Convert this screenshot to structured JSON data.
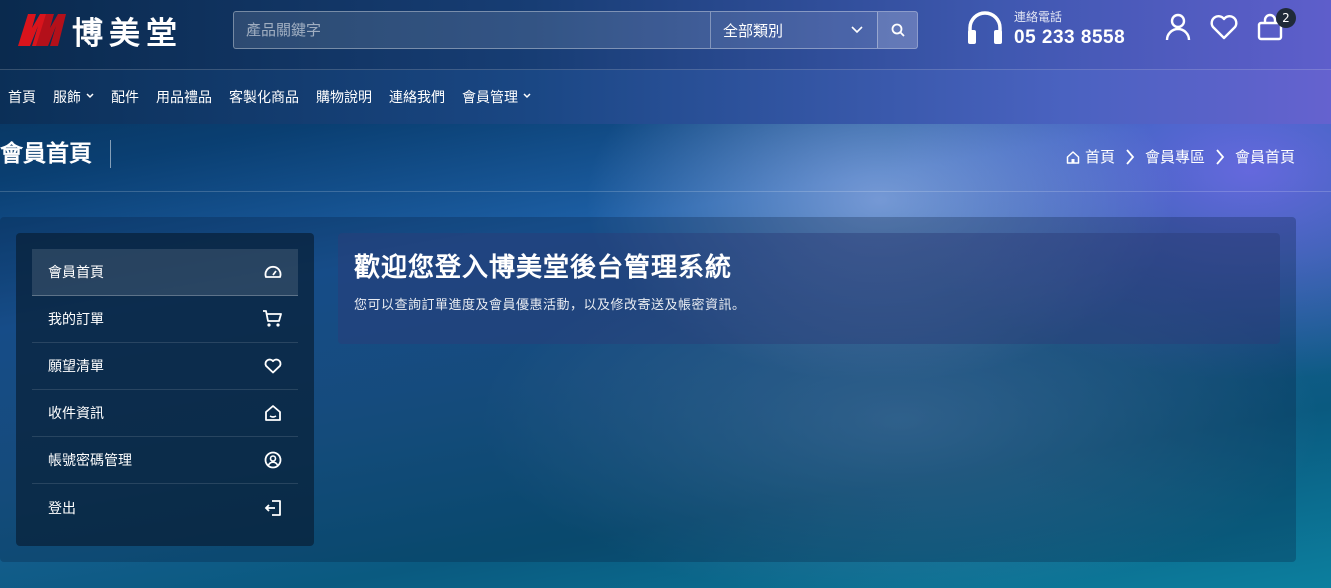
{
  "header": {
    "logo_text": "博美堂",
    "logo_mark": "M",
    "search": {
      "placeholder": "產品關鍵字",
      "value": ""
    },
    "category_select": {
      "selected": "全部類別"
    },
    "phone": {
      "label": "連絡電話",
      "number": "05 233 8558"
    },
    "cart_count": "2"
  },
  "nav": {
    "items": [
      {
        "label": "首頁",
        "dropdown": false
      },
      {
        "label": "服飾",
        "dropdown": true
      },
      {
        "label": "配件",
        "dropdown": false
      },
      {
        "label": "用品禮品",
        "dropdown": false
      },
      {
        "label": "客製化商品",
        "dropdown": false
      },
      {
        "label": "購物說明",
        "dropdown": false
      },
      {
        "label": "連絡我們",
        "dropdown": false
      },
      {
        "label": "會員管理",
        "dropdown": true
      }
    ]
  },
  "page": {
    "title": "會員首頁",
    "breadcrumb": [
      "首頁",
      "會員專區",
      "會員首頁"
    ]
  },
  "sidebar": {
    "items": [
      {
        "label": "會員首頁",
        "icon": "dashboard-icon",
        "active": true
      },
      {
        "label": "我的訂單",
        "icon": "cart-icon",
        "active": false
      },
      {
        "label": "願望清單",
        "icon": "heart-icon",
        "active": false
      },
      {
        "label": "收件資訊",
        "icon": "home-icon",
        "active": false
      },
      {
        "label": "帳號密碼管理",
        "icon": "user-circle-icon",
        "active": false
      },
      {
        "label": "登出",
        "icon": "logout-icon",
        "active": false
      }
    ]
  },
  "welcome": {
    "title": "歡迎您登入博美堂後台管理系統",
    "description": "您可以查詢訂單進度及會員優惠活動，以及修改寄送及帳密資訊。"
  },
  "colors": {
    "logo_red": "#d9141c",
    "header_start": "#0a2a4e",
    "header_end": "#5e5ecb",
    "badge": "#1f2a38"
  }
}
